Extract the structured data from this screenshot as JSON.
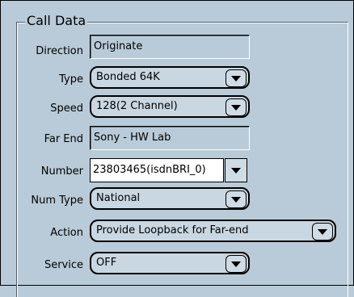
{
  "group": {
    "title": "Call Data"
  },
  "fields": {
    "direction": {
      "label": "Direction",
      "value": "Originate"
    },
    "type": {
      "label": "Type",
      "value": "Bonded 64K"
    },
    "speed": {
      "label": "Speed",
      "value": "128(2 Channel)"
    },
    "far_end": {
      "label": "Far End",
      "value": "Sony - HW Lab"
    },
    "number": {
      "label": "Number",
      "value": "23803465(isdnBRI_0)"
    },
    "num_type": {
      "label": "Num Type",
      "value": "National"
    },
    "action": {
      "label": "Action",
      "value": "Provide Loopback for Far-end"
    },
    "service": {
      "label": "Service",
      "value": "OFF"
    }
  },
  "icons": {
    "dropdown": "chevron-down-icon"
  },
  "colors": {
    "background": "#b9cbd8",
    "input_background": "#ffffff"
  }
}
